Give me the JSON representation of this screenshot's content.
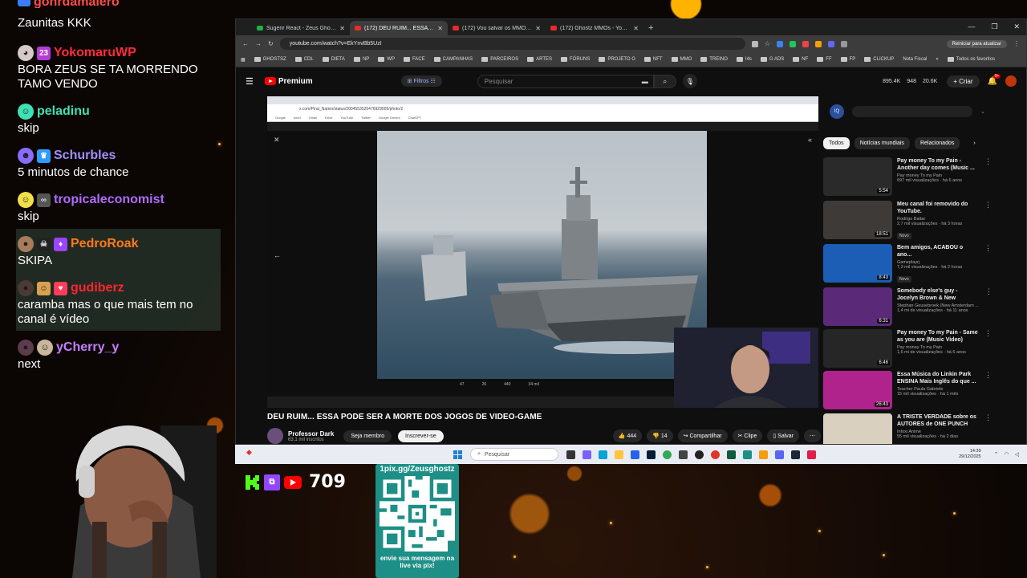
{
  "chat": {
    "top_fragment": "gonrdamalero",
    "messages": [
      {
        "user": "",
        "text": "Zaunitas KKK"
      },
      {
        "user": "YokomaruWP",
        "badge": "23",
        "text": "BORA ZEUS SE TA MORRENDO TAMO VENDO"
      },
      {
        "user": "peladinu",
        "text": "skip"
      },
      {
        "user": "Schurbles",
        "text": "5 minutos de chance"
      },
      {
        "user": "tropicaleconomist",
        "text": "skip"
      },
      {
        "user": "PedroRoak",
        "text": "SKIPA"
      },
      {
        "user": "gudiberz",
        "text": "caramba mas o que mais tem no canal é vídeo"
      },
      {
        "user": "yCherry_y",
        "text": "next"
      }
    ]
  },
  "browser": {
    "tabs": [
      {
        "label": "Sugerir React - Zeus Ghostz - G",
        "active": false
      },
      {
        "label": "(172) DEU RUIM... ESSA PODE S",
        "active": true
      },
      {
        "label": "(172) Vou salvar os MMORPGs",
        "active": false
      },
      {
        "label": "(172) Ghostz MMOs - YouTube",
        "active": false
      }
    ],
    "url": "youtube.com/watch?v=EkYnvBb5UzI",
    "reload_label": "Reiniciar para atualizar",
    "bookmarks": [
      "GHOSTSZ",
      "CDL",
      "DIETA",
      "NP",
      "WP",
      "FACE",
      "CAMPANHAS",
      "PARCEIROS",
      "ARTES",
      "FÓRUNS",
      "PROJETO G",
      "NFT",
      "MMO",
      "TREINO",
      "I4s",
      "G ADS",
      "NF",
      "FF",
      "FP",
      "CLICKUP",
      "Nota Fiscal"
    ],
    "bookmarks_all": "Todos os favoritos"
  },
  "youtube": {
    "logo": "Premium",
    "filtros": "Filtros",
    "search_placeholder": "Pesquisar",
    "stats": [
      "895.4K",
      "948",
      "20.6K"
    ],
    "create": "Criar",
    "notifications": "9+",
    "video_title": "DEU RUIM... ESSA PODE SER A MORTE DOS JOGOS DE VIDEO-GAME",
    "channel": "Professor Dark",
    "subscribers": "63,1 mil inscritos",
    "join": "Seja membro",
    "subscribe": "Inscrever-se",
    "likes": "444",
    "dislikes": "14",
    "share": "Compartilhar",
    "clip": "Clipe",
    "save": "Salvar",
    "inner_url": "x.com/Pirat_Nation/status/2004553525476929009/photo/2",
    "tweet_stats": [
      "47",
      "26",
      "440",
      "34 mil"
    ],
    "chips": [
      "Todos",
      "Notícias mundiais",
      "Relacionados"
    ],
    "recs": [
      {
        "title": "Pay money To my Pain - Another day comes (Music ...",
        "channel": "Pay money To my Pain",
        "meta": "697 mil visualizações · há 6 anos",
        "dur": "5:54",
        "novo": "",
        "bg": "#2a2a2a"
      },
      {
        "title": "Meu canal foi removido do YouTube.",
        "channel": "Rodrigo Baltar",
        "meta": "2,7 mil visualizações · há 3 horas",
        "dur": "18:51",
        "novo": "Novo",
        "bg": "#3d3a38"
      },
      {
        "title": "Bem amigos, ACABOU o ano...",
        "channel": "Gameplayrj",
        "meta": "7,3 mil visualizações · há 2 horas",
        "dur": "8:43",
        "novo": "Novo",
        "bg": "#1c5db5"
      },
      {
        "title": "Somebody else's guy - Jocelyn Brown & New Amsterdam ...",
        "channel": "Stephan Geusebroek (New Amsterdam ...",
        "meta": "1,4 mi de visualizações · há 11 anos",
        "dur": "6:31",
        "novo": "",
        "bg": "#5a2a78"
      },
      {
        "title": "Pay money To my Pain - Same as you are (Music Video)",
        "channel": "Pay money To my Pain",
        "meta": "1,6 mi de visualizações · há 6 anos",
        "dur": "6:46",
        "novo": "",
        "bg": "#262626"
      },
      {
        "title": "Essa Música do Linkin Park ENSINA Mais Inglês do que ...",
        "channel": "Teacher Paula Gabriele",
        "meta": "15 mil visualizações · há 1 mês",
        "dur": "26:43",
        "novo": "",
        "bg": "#b0238c"
      },
      {
        "title": "A TRISTE VERDADE sobre os AUTORES de ONE PUNCH MAN",
        "channel": "Intoxi Anime",
        "meta": "55 mil visualizações · há 2 dias",
        "dur": "",
        "novo": "",
        "bg": "#d9d0c0"
      }
    ]
  },
  "taskbar": {
    "search": "Pesquisar",
    "time": "14:39",
    "date": "29/12/2025"
  },
  "overlay": {
    "follower_count": "709",
    "pix_title": "1pix.gg/Zeusghostz",
    "pix_footer": "envie sua mensagem na live via pix!"
  },
  "colors": {
    "yokomaru": "#ff2b3a",
    "peladinu": "#3fe0b4",
    "schurbles": "#a38cff",
    "tropical": "#b06cff",
    "pedroroak": "#ff7a1a",
    "gudiberz": "#ff2432",
    "cherry": "#c77dff"
  }
}
